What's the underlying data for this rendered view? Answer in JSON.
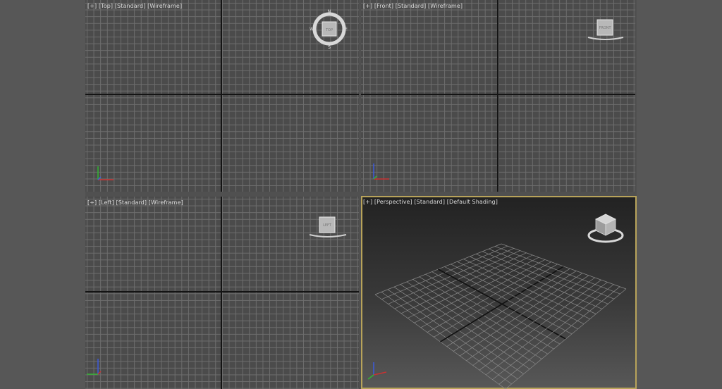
{
  "viewports": {
    "top": {
      "label": [
        "[+]",
        "[Top]",
        "[Standard]",
        "[Wireframe]"
      ],
      "cube_face": "TOP",
      "compass": {
        "n": "N",
        "s": "S",
        "e": "E",
        "w": "W"
      }
    },
    "front": {
      "label": [
        "[+]",
        "[Front]",
        "[Standard]",
        "[Wireframe]"
      ],
      "cube_face": "FRONT"
    },
    "left": {
      "label": [
        "[+]",
        "[Left]",
        "[Standard]",
        "[Wireframe]"
      ],
      "cube_face": "LEFT"
    },
    "perspective": {
      "label": [
        "[+]",
        "[Perspective]",
        "[Standard]",
        "[Default Shading]"
      ]
    }
  },
  "colors": {
    "background": "#575757",
    "grid_line": "#6e6e6e",
    "axis_line": "#141414",
    "active_border": "#b8a35a",
    "axis_x": "#c83232",
    "axis_y": "#32b432",
    "axis_z": "#3c5adc"
  },
  "icons": [
    "viewcube-icon",
    "compass-ring-icon",
    "axis-tripod-icon"
  ]
}
